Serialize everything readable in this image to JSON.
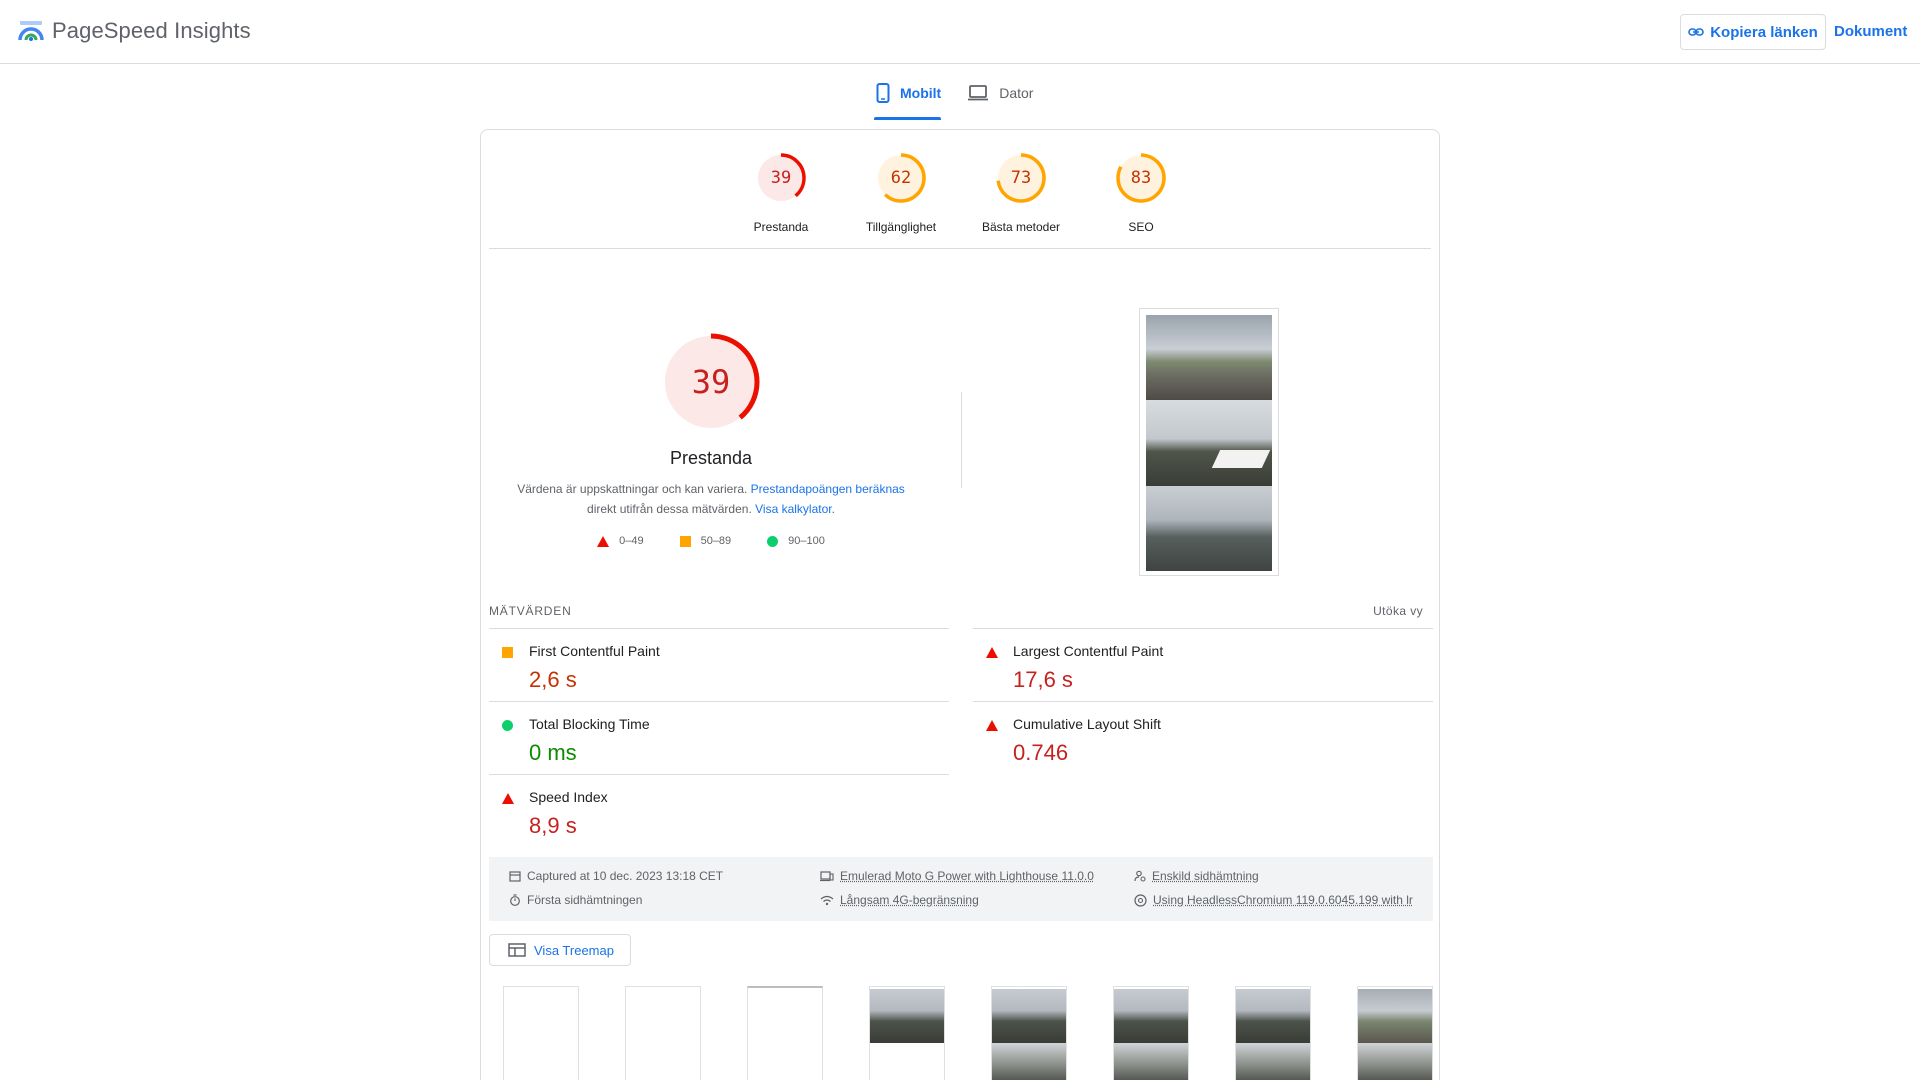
{
  "header": {
    "brand": "PageSpeed Insights",
    "copy_link": "Kopiera länken",
    "docs": "Dokument"
  },
  "tabs": [
    {
      "label": "Mobilt",
      "active": true,
      "icon": "phone-icon"
    },
    {
      "label": "Dator",
      "active": false,
      "icon": "laptop-icon"
    }
  ],
  "scores": [
    {
      "label": "Prestanda",
      "value": "39",
      "color": "#eb0f00",
      "fraction": 0.39
    },
    {
      "label": "Tillgänglighet",
      "value": "62",
      "color": "#ffa400",
      "fraction": 0.62
    },
    {
      "label": "Bästa metoder",
      "value": "73",
      "color": "#ffa400",
      "fraction": 0.73
    },
    {
      "label": "SEO",
      "value": "83",
      "color": "#ffa400",
      "fraction": 0.83
    }
  ],
  "performance": {
    "score": "39",
    "title": "Prestanda",
    "desc_1": "Värdena är uppskattningar och kan variera.",
    "desc_link_1": "Prestandapoängen beräknas",
    "desc_2": "direkt utifrån dessa mätvärden.",
    "desc_link_2": "Visa kalkylator",
    "desc_end": "."
  },
  "legend": [
    {
      "range": "0–49",
      "shape": "triangle",
      "color": "#eb0f00"
    },
    {
      "range": "50–89",
      "shape": "square",
      "color": "#ffa400"
    },
    {
      "range": "90–100",
      "shape": "circle",
      "color": "#0cce6b"
    }
  ],
  "metrics_header": {
    "title": "MÄTVÄRDEN",
    "expand": "Utöka vy"
  },
  "metrics": [
    {
      "name": "First Contentful Paint",
      "value": "2,6 s",
      "status": "average"
    },
    {
      "name": "Largest Contentful Paint",
      "value": "17,6 s",
      "status": "fail"
    },
    {
      "name": "Total Blocking Time",
      "value": "0 ms",
      "status": "pass"
    },
    {
      "name": "Cumulative Layout Shift",
      "value": "0.746",
      "status": "fail"
    },
    {
      "name": "Speed Index",
      "value": "8,9 s",
      "status": "fail"
    }
  ],
  "info": {
    "captured": "Captured at 10 dec. 2023 13:18 CET",
    "first_load": "Första sidhämtningen",
    "device": "Emulerad Moto G Power with Lighthouse 11.0.0",
    "throttle": "Långsam 4G-begränsning",
    "single": "Enskild sidhämtning",
    "browser": "Using HeadlessChromium 119.0.6045.199 with lr"
  },
  "treemap": "Visa Treemap",
  "colors": {
    "accent": "#1a73e8",
    "fail": "#eb0f00",
    "average": "#ffa400",
    "pass": "#0cce6b"
  }
}
